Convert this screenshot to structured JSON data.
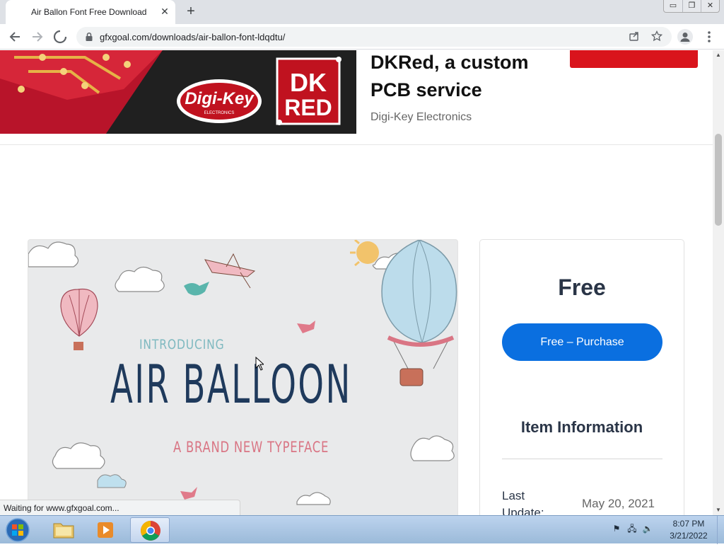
{
  "browser": {
    "tab_title": "Air Ballon Font Free Download",
    "tab_close": "✕",
    "new_tab": "+",
    "url": "gfxgoal.com/downloads/air-ballon-font-ldqdtu/",
    "window_buttons": [
      "▭",
      "❐",
      "✕"
    ],
    "status_text": "Waiting for www.gfxgoal.com..."
  },
  "ad": {
    "headline": "DKRed, a custom PCB service",
    "sponsor": "Digi-Key Electronics",
    "logo_text": "Digi-Key",
    "logo_sub": "ELECTRONICS",
    "badge_line1": "DK",
    "badge_line2": "RED"
  },
  "preview": {
    "intro": "INTRODUCING",
    "title": "AIR BALLOON",
    "subtitle": "A BRAND NEW TYPEFACE"
  },
  "product": {
    "price": "Free",
    "purchase_label": "Free – Purchase",
    "info_title": "Item Information",
    "last_update_label": "Last Update:",
    "last_update_value": "May 20, 2021"
  },
  "taskbar": {
    "time": "8:07 PM",
    "date": "3/21/2022"
  },
  "colors": {
    "accent": "#0a6fe0",
    "heading": "#2a3547",
    "ad_red": "#d9141c"
  }
}
